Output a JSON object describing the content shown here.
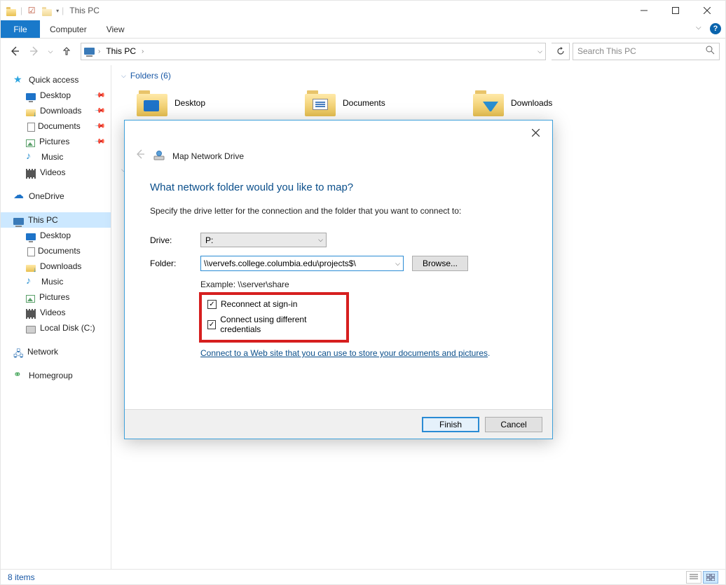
{
  "window": {
    "title": "This PC"
  },
  "ribbon": {
    "file": "File",
    "tabs": [
      "Computer",
      "View"
    ]
  },
  "nav": {
    "address_label": "This PC",
    "search_placeholder": "Search This PC"
  },
  "sidebar": {
    "quick_access": "Quick access",
    "pinned": [
      {
        "label": "Desktop",
        "icon": "monitor"
      },
      {
        "label": "Downloads",
        "icon": "down"
      },
      {
        "label": "Documents",
        "icon": "doc"
      },
      {
        "label": "Pictures",
        "icon": "pic"
      }
    ],
    "recent": [
      {
        "label": "Music",
        "icon": "music"
      },
      {
        "label": "Videos",
        "icon": "vid"
      }
    ],
    "onedrive": "OneDrive",
    "thispc": "This PC",
    "thispc_children": [
      {
        "label": "Desktop",
        "icon": "monitor"
      },
      {
        "label": "Documents",
        "icon": "doc"
      },
      {
        "label": "Downloads",
        "icon": "down"
      },
      {
        "label": "Music",
        "icon": "music"
      },
      {
        "label": "Pictures",
        "icon": "pic"
      },
      {
        "label": "Videos",
        "icon": "vid"
      },
      {
        "label": "Local Disk (C:)",
        "icon": "disk"
      }
    ],
    "network": "Network",
    "homegroup": "Homegroup"
  },
  "content": {
    "group_label": "Folders (6)",
    "items": [
      "Desktop",
      "Documents",
      "Downloads"
    ]
  },
  "dialog": {
    "title": "Map Network Drive",
    "heading": "What network folder would you like to map?",
    "subheading": "Specify the drive letter for the connection and the folder that you want to connect to:",
    "drive_label": "Drive:",
    "drive_value": "P:",
    "folder_label": "Folder:",
    "folder_value": "\\\\vervefs.college.columbia.edu\\projects$\\",
    "browse": "Browse...",
    "example": "Example: \\\\server\\share",
    "reconnect": "Reconnect at sign-in",
    "diffcred": "Connect using different credentials",
    "link_text": "Connect to a Web site that you can use to store your documents and pictures",
    "finish": "Finish",
    "cancel": "Cancel"
  },
  "status": {
    "text": "8 items"
  }
}
